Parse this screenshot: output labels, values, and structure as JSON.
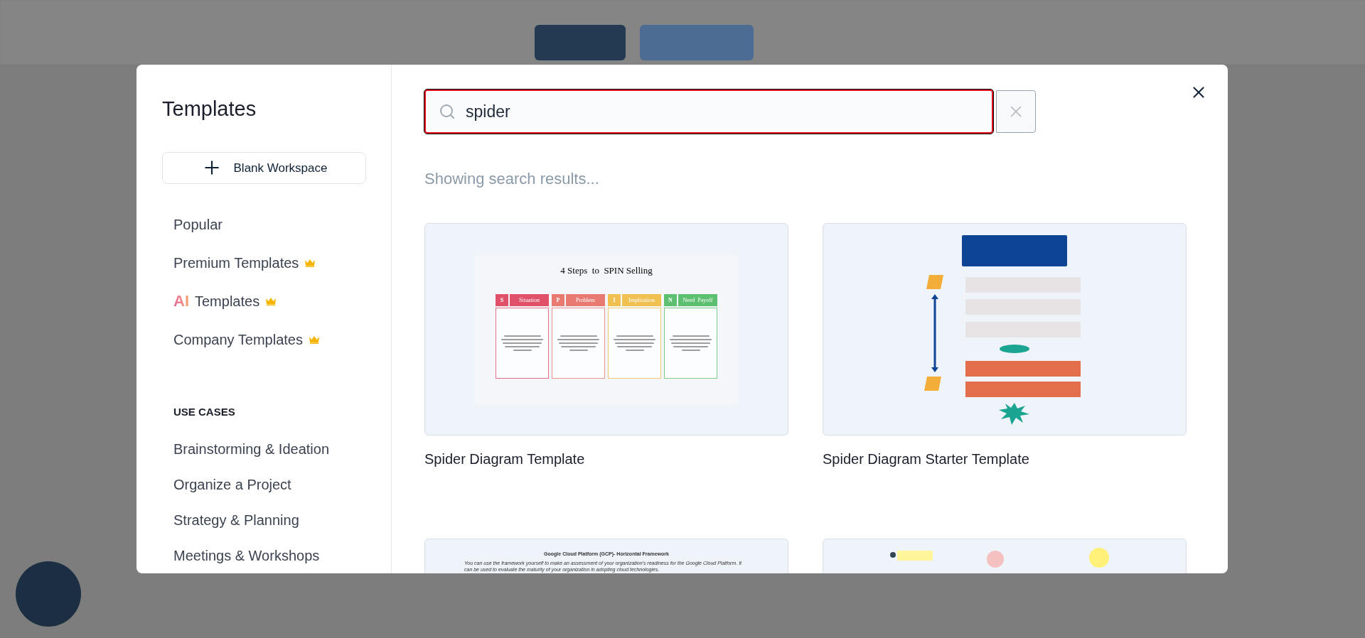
{
  "sidebar": {
    "title": "Templates",
    "blank_button": "Blank Workspace",
    "nav": [
      {
        "label": "Popular",
        "premium": false,
        "kind": "plain"
      },
      {
        "label": "Premium Templates",
        "premium": true,
        "kind": "plain"
      },
      {
        "label": "Templates",
        "premium": true,
        "kind": "ai",
        "badge": "AI"
      },
      {
        "label": "Company Templates",
        "premium": true,
        "kind": "plain"
      }
    ],
    "section_heading": "USE CASES",
    "use_cases": [
      "Brainstorming & Ideation",
      "Organize a Project",
      "Strategy & Planning",
      "Meetings & Workshops"
    ]
  },
  "search": {
    "value": "spider"
  },
  "status": "Showing search results...",
  "results": [
    {
      "kind": "spin",
      "title": "Spider Diagram Template",
      "preview_title": "4 Steps  to  SPIN Selling",
      "steps": [
        {
          "letter": "S",
          "label": "Situation",
          "color": "#e05068"
        },
        {
          "letter": "P",
          "label": "Problem",
          "color": "#e87a72"
        },
        {
          "letter": "I",
          "label": "Implication",
          "color": "#f0c050"
        },
        {
          "letter": "N",
          "label": "Need  Payoff",
          "color": "#5cc070"
        }
      ]
    },
    {
      "kind": "flow",
      "title": "Spider Diagram Starter Template"
    },
    {
      "kind": "gcp",
      "preview_title": "Google Cloud Platform (GCP)- Horizontal Framework",
      "preview_text": "You can use the framework yourself to make an assessment of your organization's readiness for the Google Cloud Platform. It can be used to evaluate the maturity of your organization in adopting cloud technologies."
    },
    {
      "kind": "canvas"
    }
  ]
}
